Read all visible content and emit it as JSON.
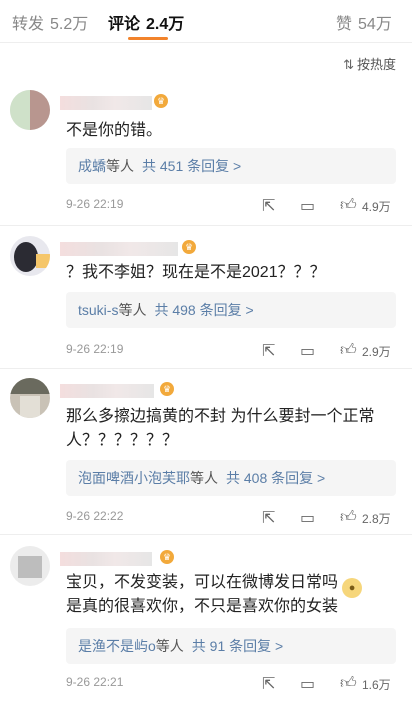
{
  "tabs": {
    "repost": {
      "label": "转发",
      "count": "5.2万"
    },
    "comment": {
      "label": "评论",
      "count": "2.4万"
    },
    "like": {
      "label": "赞",
      "count": "54万"
    }
  },
  "sort": {
    "label": "按热度",
    "icon": "sort-icon"
  },
  "colors": {
    "accent": "#f2832b",
    "link": "#5b7ea7"
  },
  "comments": [
    {
      "text": "不是你的错。",
      "reply_users": "成蟜",
      "reply_suffix": "等人",
      "reply_count": "共 451 条回复 >",
      "time": "9-26 22:19",
      "likes": "4.9万"
    },
    {
      "text": "？我不李姐？现在是不是2021？？？",
      "reply_users": "tsuki-s",
      "reply_suffix": "等人",
      "reply_count": "共 498 条回复 >",
      "time": "9-26 22:19",
      "likes": "2.9万"
    },
    {
      "text_line1": "那么多擦边搞黄的不封 为什么要封一个正常",
      "text_line2": "人？？？？？？",
      "reply_users": "泡面啤酒小泡芙耶",
      "reply_suffix": "等人",
      "reply_count": "共 408 条回复 >",
      "time": "9-26 22:22",
      "likes": "2.8万"
    },
    {
      "text_line1": "宝贝，不发变装，可以在微博发日常吗",
      "text_line2": "是真的很喜欢你，不只是喜欢你的女装",
      "reply_users": "是渔不是屿o",
      "reply_suffix": "等人",
      "reply_count": "共 91 条回复 >",
      "time": "9-26 22:21",
      "likes": "1.6万"
    }
  ]
}
